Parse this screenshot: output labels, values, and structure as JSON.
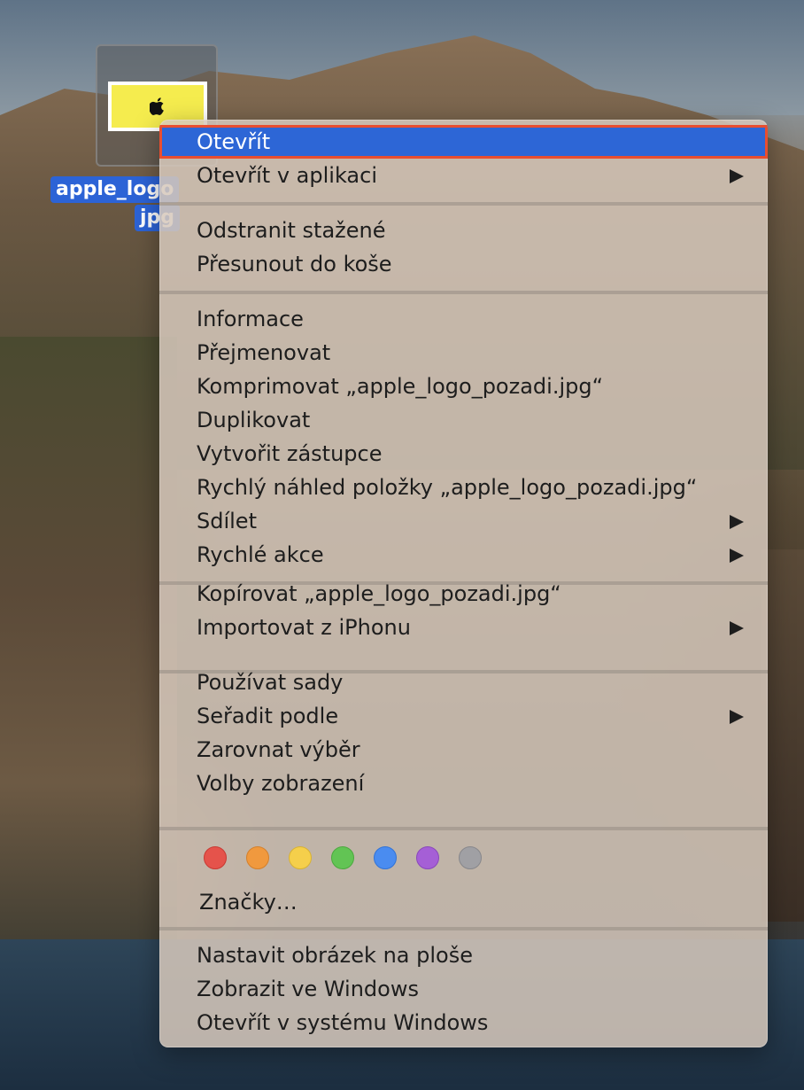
{
  "desktop_file": {
    "label_line1": "apple_logo",
    "label_line2": "jpg",
    "icon": "image-file-icon",
    "thumbnail_color": "#f5ec4e"
  },
  "context_menu": {
    "groups": [
      [
        {
          "label": "Otevřít",
          "submenu": false,
          "highlighted": true
        },
        {
          "label": "Otevřít v aplikaci",
          "submenu": true
        }
      ],
      [
        {
          "label": "Odstranit stažené",
          "submenu": false
        },
        {
          "label": "Přesunout do koše",
          "submenu": false
        }
      ],
      [
        {
          "label": "Informace",
          "submenu": false
        },
        {
          "label": "Přejmenovat",
          "submenu": false
        },
        {
          "label": "Komprimovat „apple_logo_pozadi.jpg“",
          "submenu": false
        },
        {
          "label": "Duplikovat",
          "submenu": false
        },
        {
          "label": "Vytvořit zástupce",
          "submenu": false
        },
        {
          "label": "Rychlý náhled položky „apple_logo_pozadi.jpg“",
          "submenu": false
        },
        {
          "label": "Sdílet",
          "submenu": true
        },
        {
          "label": "Rychlé akce",
          "submenu": true
        }
      ],
      [
        {
          "label": "Kopírovat „apple_logo_pozadi.jpg“",
          "submenu": false
        },
        {
          "label": "Importovat z iPhonu",
          "submenu": true
        }
      ],
      [
        {
          "label": "Používat sady",
          "submenu": false
        },
        {
          "label": "Seřadit podle",
          "submenu": true
        },
        {
          "label": "Zarovnat výběr",
          "submenu": false
        },
        {
          "label": "Volby zobrazení",
          "submenu": false
        }
      ],
      [
        {
          "label": "Nastavit obrázek na ploše",
          "submenu": false
        },
        {
          "label": "Zobrazit ve Windows",
          "submenu": false
        },
        {
          "label": "Otevřít v systému Windows",
          "submenu": false
        }
      ]
    ],
    "tags": {
      "label": "Značky…",
      "colors": [
        {
          "name": "red",
          "fill": "#e5534b",
          "stroke": "#c83a33"
        },
        {
          "name": "orange",
          "fill": "#f0993e",
          "stroke": "#d4802c"
        },
        {
          "name": "yellow",
          "fill": "#f5cf4b",
          "stroke": "#d7b235"
        },
        {
          "name": "green",
          "fill": "#62c454",
          "stroke": "#4ca83f"
        },
        {
          "name": "blue",
          "fill": "#4a8cf0",
          "stroke": "#3273d6"
        },
        {
          "name": "purple",
          "fill": "#a55fd6",
          "stroke": "#8a48bb"
        },
        {
          "name": "gray",
          "fill": "#a0a0a4",
          "stroke": "#87878b"
        }
      ]
    }
  },
  "colors": {
    "highlight": "#2d66d6",
    "highlight_outline": "#e84e30",
    "selection_label": "#2c63d6"
  }
}
